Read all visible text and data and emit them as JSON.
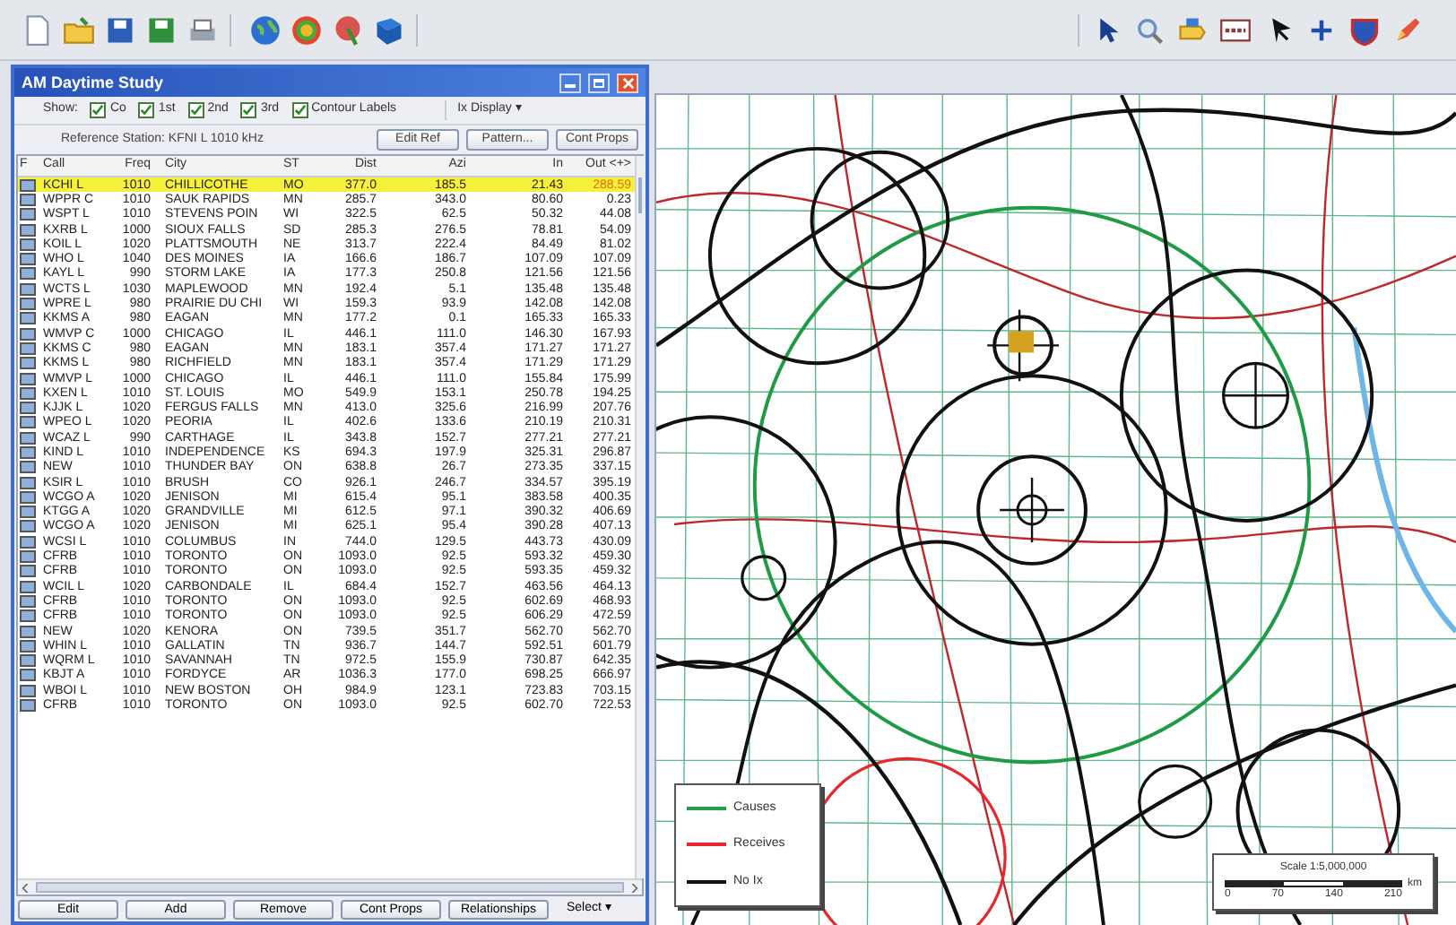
{
  "window": {
    "title": "AM Daytime Study"
  },
  "show": {
    "label": "Show:",
    "options": [
      {
        "label": "Co",
        "checked": true
      },
      {
        "label": "1st",
        "checked": true
      },
      {
        "label": "2nd",
        "checked": true
      },
      {
        "label": "3rd",
        "checked": true
      },
      {
        "label": "Contour Labels",
        "checked": true
      }
    ],
    "dropdown": "Ix Display ▾"
  },
  "reference": {
    "label": "Reference Station: KFNI L 1010 kHz",
    "buttons": [
      "Edit Ref",
      "Pattern...",
      "Cont Props"
    ]
  },
  "table": {
    "columns": [
      "F",
      "Call",
      "Freq",
      "City",
      "ST",
      "Dist",
      "Azi",
      "In",
      "Out <+>"
    ],
    "rows": [
      {
        "checked": true,
        "selected": true,
        "cells": [
          "",
          "KCHI L",
          "1010",
          "CHILLICOTHE",
          "MO",
          "377.0",
          "185.5",
          "21.43",
          "288.59"
        ]
      },
      {
        "checked": true,
        "selected": false,
        "cells": [
          "",
          "WPPR C",
          "1010",
          "SAUK RAPIDS",
          "MN",
          "285.7",
          "343.0",
          "80.60",
          "0.23"
        ]
      },
      {
        "checked": true,
        "selected": false,
        "cells": [
          "",
          "WSPT L",
          "1010",
          "STEVENS POIN",
          "WI",
          "322.5",
          "62.5",
          "50.32",
          "44.08"
        ]
      },
      {
        "checked": true,
        "selected": false,
        "cells": [
          "",
          "KXRB L",
          "1000",
          "SIOUX FALLS",
          "SD",
          "285.3",
          "276.5",
          "78.81",
          "54.09"
        ]
      },
      {
        "checked": true,
        "selected": false,
        "cells": [
          "",
          "KOIL L",
          "1020",
          "PLATTSMOUTH",
          "NE",
          "313.7",
          "222.4",
          "84.49",
          "81.02"
        ]
      },
      {
        "checked": true,
        "selected": false,
        "cells": [
          "",
          "WHO L",
          "1040",
          "DES MOINES",
          "IA",
          "166.6",
          "186.7",
          "107.09",
          "107.09"
        ]
      },
      {
        "checked": true,
        "selected": false,
        "cells": [
          "",
          "KAYL L",
          "990",
          "STORM LAKE",
          "IA",
          "177.3",
          "250.8",
          "121.56",
          "121.56"
        ]
      },
      {
        "checked": true,
        "selected": false,
        "cells": [
          "",
          "WCTS L",
          "1030",
          "MAPLEWOOD",
          "MN",
          "192.4",
          "5.1",
          "135.48",
          "135.48"
        ]
      },
      {
        "checked": true,
        "selected": false,
        "cells": [
          "",
          "WPRE L",
          "980",
          "PRAIRIE DU CHI",
          "WI",
          "159.3",
          "93.9",
          "142.08",
          "142.08"
        ]
      },
      {
        "checked": true,
        "selected": false,
        "cells": [
          "",
          "KKMS A",
          "980",
          "EAGAN",
          "MN",
          "177.2",
          "0.1",
          "165.33",
          "165.33"
        ]
      },
      {
        "checked": true,
        "selected": false,
        "cells": [
          "",
          "WMVP C",
          "1000",
          "CHICAGO",
          "IL",
          "446.1",
          "111.0",
          "146.30",
          "167.93"
        ]
      },
      {
        "checked": true,
        "selected": false,
        "cells": [
          "",
          "KKMS C",
          "980",
          "EAGAN",
          "MN",
          "183.1",
          "357.4",
          "171.27",
          "171.27"
        ]
      },
      {
        "checked": true,
        "selected": false,
        "cells": [
          "",
          "KKMS L",
          "980",
          "RICHFIELD",
          "MN",
          "183.1",
          "357.4",
          "171.29",
          "171.29"
        ]
      },
      {
        "checked": true,
        "selected": false,
        "cells": [
          "",
          "WMVP L",
          "1000",
          "CHICAGO",
          "IL",
          "446.1",
          "111.0",
          "155.84",
          "175.99"
        ]
      },
      {
        "checked": true,
        "selected": false,
        "cells": [
          "",
          "KXEN L",
          "1010",
          "ST. LOUIS",
          "MO",
          "549.9",
          "153.1",
          "250.78",
          "194.25"
        ]
      },
      {
        "checked": true,
        "selected": false,
        "cells": [
          "",
          "KJJK L",
          "1020",
          "FERGUS FALLS",
          "MN",
          "413.0",
          "325.6",
          "216.99",
          "207.76"
        ]
      },
      {
        "checked": true,
        "selected": false,
        "cells": [
          "",
          "WPEO L",
          "1020",
          "PEORIA",
          "IL",
          "402.6",
          "133.6",
          "210.19",
          "210.31"
        ]
      },
      {
        "checked": true,
        "selected": false,
        "cells": [
          "",
          "WCAZ L",
          "990",
          "CARTHAGE",
          "IL",
          "343.8",
          "152.7",
          "277.21",
          "277.21"
        ]
      },
      {
        "checked": true,
        "selected": false,
        "cells": [
          "",
          "KIND L",
          "1010",
          "INDEPENDENCE",
          "KS",
          "694.3",
          "197.9",
          "325.31",
          "296.87"
        ]
      },
      {
        "checked": true,
        "selected": false,
        "cells": [
          "",
          "NEW",
          "1010",
          "THUNDER BAY",
          "ON",
          "638.8",
          "26.7",
          "273.35",
          "337.15"
        ]
      },
      {
        "checked": true,
        "selected": false,
        "cells": [
          "",
          "KSIR L",
          "1010",
          "BRUSH",
          "CO",
          "926.1",
          "246.7",
          "334.57",
          "395.19"
        ]
      },
      {
        "checked": true,
        "selected": false,
        "cells": [
          "",
          "WCGO A",
          "1020",
          "JENISON",
          "MI",
          "615.4",
          "95.1",
          "383.58",
          "400.35"
        ]
      },
      {
        "checked": true,
        "selected": false,
        "cells": [
          "",
          "KTGG A",
          "1020",
          "GRANDVILLE",
          "MI",
          "612.5",
          "97.1",
          "390.32",
          "406.69"
        ]
      },
      {
        "checked": true,
        "selected": false,
        "cells": [
          "",
          "WCGO A",
          "1020",
          "JENISON",
          "MI",
          "625.1",
          "95.4",
          "390.28",
          "407.13"
        ]
      },
      {
        "checked": true,
        "selected": false,
        "cells": [
          "",
          "WCSI L",
          "1010",
          "COLUMBUS",
          "IN",
          "744.0",
          "129.5",
          "443.73",
          "430.09"
        ]
      },
      {
        "checked": true,
        "selected": false,
        "cells": [
          "",
          "CFRB",
          "1010",
          "TORONTO",
          "ON",
          "1093.0",
          "92.5",
          "593.32",
          "459.30"
        ]
      },
      {
        "checked": true,
        "selected": false,
        "cells": [
          "",
          "CFRB",
          "1010",
          "TORONTO",
          "ON",
          "1093.0",
          "92.5",
          "593.35",
          "459.32"
        ]
      },
      {
        "checked": true,
        "selected": false,
        "cells": [
          "",
          "WCIL L",
          "1020",
          "CARBONDALE",
          "IL",
          "684.4",
          "152.7",
          "463.56",
          "464.13"
        ]
      },
      {
        "checked": true,
        "selected": false,
        "cells": [
          "",
          "CFRB",
          "1010",
          "TORONTO",
          "ON",
          "1093.0",
          "92.5",
          "602.69",
          "468.93"
        ]
      },
      {
        "checked": true,
        "selected": false,
        "cells": [
          "",
          "CFRB",
          "1010",
          "TORONTO",
          "ON",
          "1093.0",
          "92.5",
          "606.29",
          "472.59"
        ]
      },
      {
        "checked": true,
        "selected": false,
        "cells": [
          "",
          "NEW",
          "1020",
          "KENORA",
          "ON",
          "739.5",
          "351.7",
          "562.70",
          "562.70"
        ]
      },
      {
        "checked": true,
        "selected": false,
        "cells": [
          "",
          "WHIN L",
          "1010",
          "GALLATIN",
          "TN",
          "936.7",
          "144.7",
          "592.51",
          "601.79"
        ]
      },
      {
        "checked": true,
        "selected": false,
        "cells": [
          "",
          "WQRM L",
          "1010",
          "SAVANNAH",
          "TN",
          "972.5",
          "155.9",
          "730.87",
          "642.35"
        ]
      },
      {
        "checked": true,
        "selected": false,
        "cells": [
          "",
          "KBJT A",
          "1010",
          "FORDYCE",
          "AR",
          "1036.3",
          "177.0",
          "698.25",
          "666.97"
        ]
      },
      {
        "checked": true,
        "selected": false,
        "cells": [
          "",
          "WBOI L",
          "1010",
          "NEW BOSTON",
          "OH",
          "984.9",
          "123.1",
          "723.83",
          "703.15"
        ]
      },
      {
        "checked": true,
        "selected": false,
        "cells": [
          "",
          "CFRB",
          "1010",
          "TORONTO",
          "ON",
          "1093.0",
          "92.5",
          "602.70",
          "722.53"
        ]
      }
    ]
  },
  "bottom_buttons": [
    {
      "kind": "button",
      "label": "Edit"
    },
    {
      "kind": "button",
      "label": "Add"
    },
    {
      "kind": "button",
      "label": "Remove"
    },
    {
      "kind": "button",
      "label": "Cont Props"
    },
    {
      "kind": "button",
      "label": "Relationships"
    },
    {
      "kind": "dropdown",
      "label": "Select ▾"
    }
  ],
  "map": {
    "legend": [
      {
        "label": "Causes",
        "color": "#22a04a"
      },
      {
        "label": "Receives",
        "color": "#e8262b"
      },
      {
        "label": "No Ix",
        "color": "#111111"
      }
    ],
    "scale": {
      "title": "Scale 1:5,000,000",
      "ticks": [
        "0",
        "70",
        "140",
        "210"
      ],
      "unit": "km"
    }
  }
}
